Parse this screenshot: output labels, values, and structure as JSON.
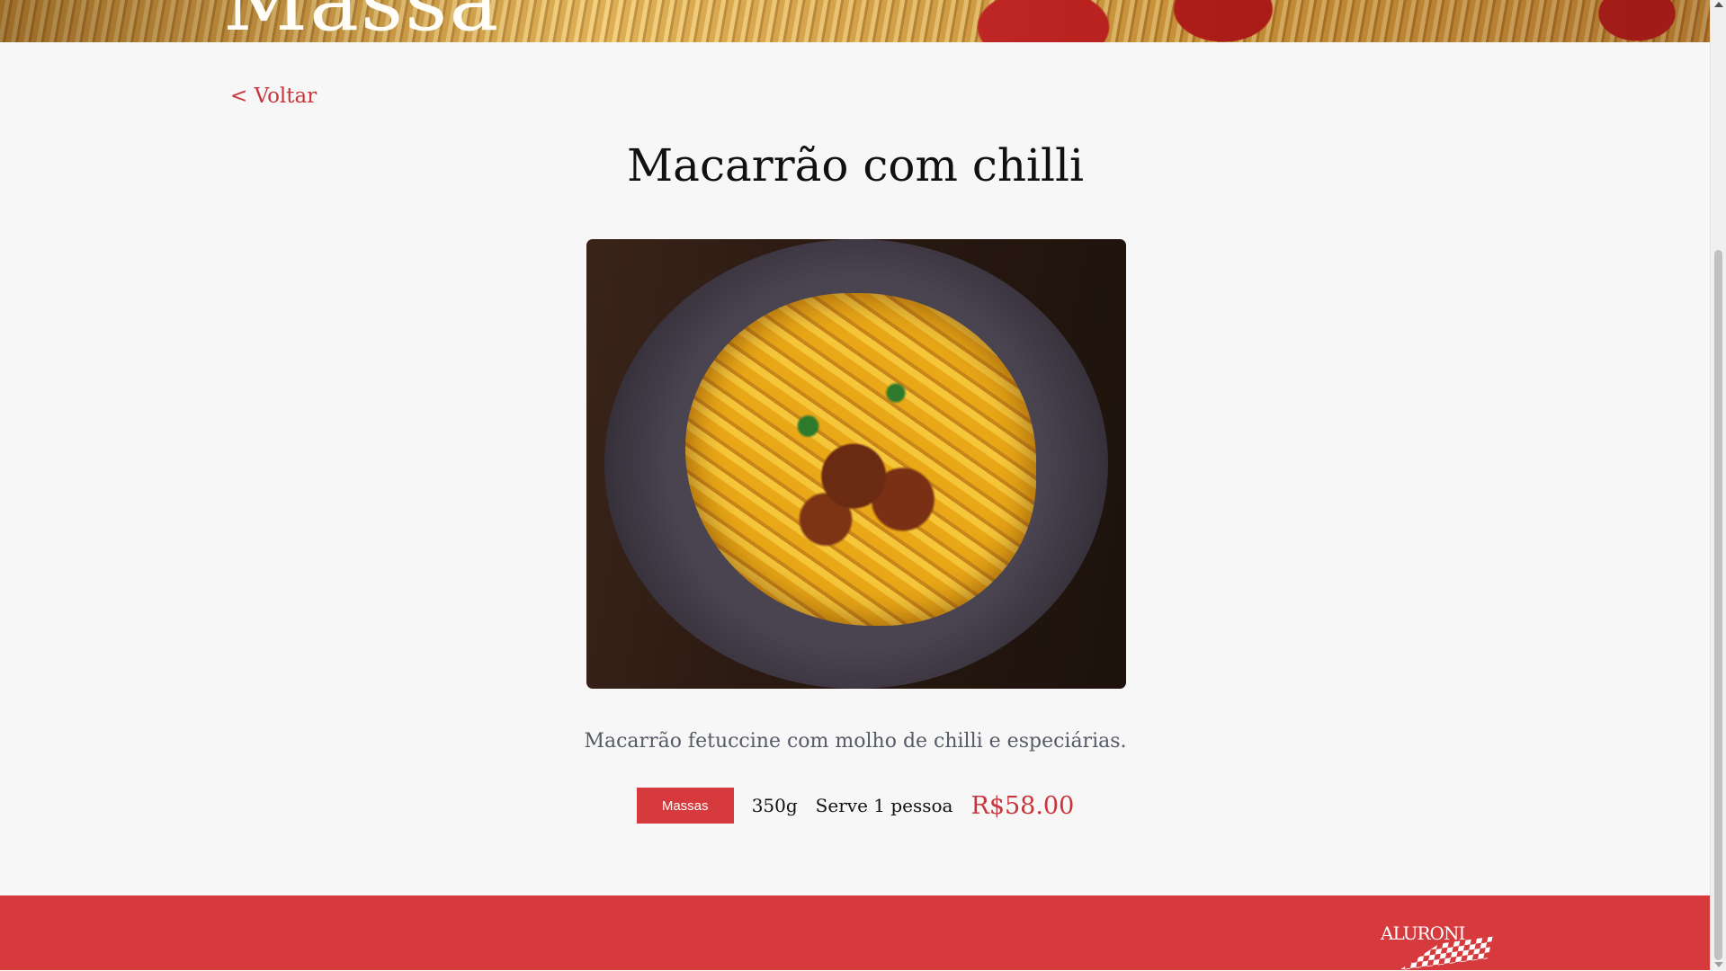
{
  "hero": {
    "title": "Massa"
  },
  "nav": {
    "back_label": "< Voltar"
  },
  "dish": {
    "title": "Macarrão com chilli",
    "description": "Macarrão fetuccine com molho de chilli e especiárias.",
    "category": "Massas",
    "weight": "350g",
    "servings": "Serve 1 pessoa",
    "price": "R$58.00",
    "image_alt": "Macarrão com chilli"
  },
  "footer": {
    "logo_text": "ALURONI"
  },
  "colors": {
    "accent": "#d63a3d",
    "link": "#c8353b",
    "background": "#f7f7f7"
  }
}
